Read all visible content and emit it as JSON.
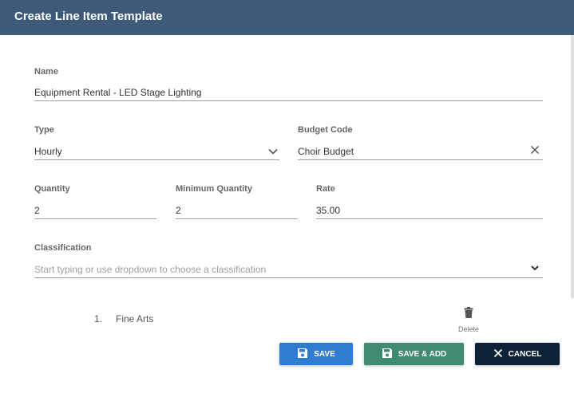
{
  "dialog": {
    "title": "Create Line Item Template"
  },
  "form": {
    "name": {
      "label": "Name",
      "value": "Equipment Rental - LED Stage Lighting"
    },
    "type": {
      "label": "Type",
      "value": "Hourly"
    },
    "budget_code": {
      "label": "Budget Code",
      "value": "Choir Budget"
    },
    "quantity": {
      "label": "Quantity",
      "value": "2"
    },
    "minimum_quantity": {
      "label": "Minimum Quantity",
      "value": "2"
    },
    "rate": {
      "label": "Rate",
      "value": "35.00"
    },
    "classification": {
      "label": "Classification",
      "placeholder": "Start typing or use dropdown to choose a classification"
    }
  },
  "classifications": [
    {
      "number": "1.",
      "name": "Fine Arts",
      "delete_label": "Delete"
    }
  ],
  "buttons": {
    "save": "SAVE",
    "save_add": "SAVE & ADD",
    "cancel": "CANCEL"
  },
  "colors": {
    "header": "#3d5a78",
    "save": "#2f7dd3",
    "save_add": "#3f8a73",
    "cancel": "#0d2236"
  },
  "icons": {
    "type_dropdown": "chevron-down-icon",
    "budget_clear": "close-icon",
    "classification_dropdown": "chevron-down-icon",
    "delete": "trash-icon",
    "save": "floppy-disk-icon",
    "save_add": "floppy-disk-icon",
    "cancel": "close-icon"
  }
}
